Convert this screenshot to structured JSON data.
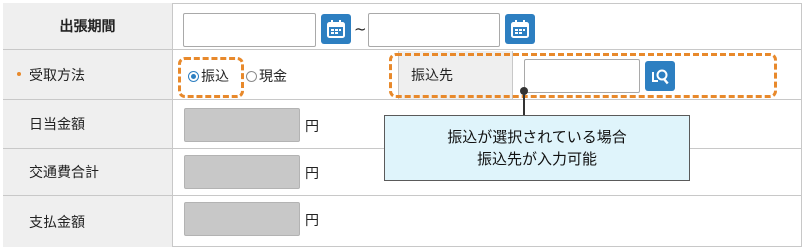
{
  "form": {
    "rows": [
      {
        "label": "出張期間",
        "range_sep": "~"
      },
      {
        "label": "受取方法",
        "options": [
          "振込",
          "現金"
        ],
        "selected": "振込",
        "destination_label": "振込先"
      },
      {
        "label": "日当金額",
        "unit": "円"
      },
      {
        "label": "交通費合計",
        "unit": "円"
      },
      {
        "label": "支払金額",
        "unit": "円"
      }
    ]
  },
  "callout": {
    "line1": "振込が選択されている場合",
    "line2": "振込先が入力可能"
  },
  "colors": {
    "accent": "#2d7fc1",
    "highlight": "#e8892b",
    "callout_bg": "#dff4fb",
    "label_bg": "#efefef"
  },
  "icons": [
    "calendar-icon",
    "search-list-icon"
  ]
}
